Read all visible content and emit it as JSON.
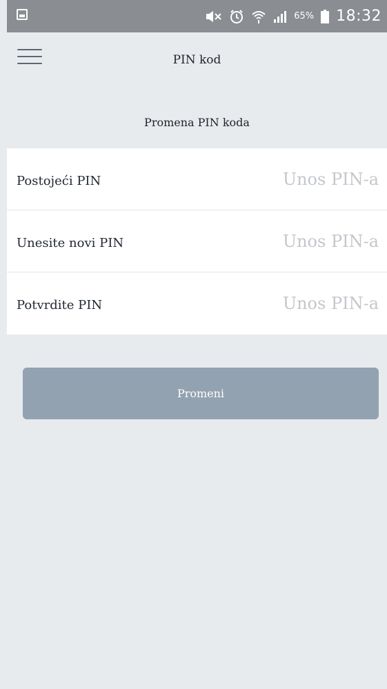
{
  "status_bar": {
    "battery": "65%",
    "time": "18:32",
    "icons": [
      "gallery-icon",
      "mute-icon",
      "alarm-icon",
      "wifi-icon",
      "signal-icon",
      "battery-icon"
    ]
  },
  "header": {
    "title": "PIN kod",
    "menu_icon": "hamburger-menu-icon"
  },
  "section": {
    "title": "Promena PIN koda"
  },
  "form": {
    "fields": [
      {
        "label": "Postojeći PIN",
        "placeholder": "Unos PIN-a",
        "value": ""
      },
      {
        "label": "Unesite novi PIN",
        "placeholder": "Unos PIN-a",
        "value": ""
      },
      {
        "label": "Potvrdite PIN",
        "placeholder": "Unos PIN-a",
        "value": ""
      }
    ]
  },
  "actions": {
    "submit_label": "Promeni"
  },
  "colors": {
    "background": "#e8ebee",
    "status_bar": "#8a8d91",
    "button": "#92a2b1",
    "placeholder": "#c3c7cc"
  }
}
